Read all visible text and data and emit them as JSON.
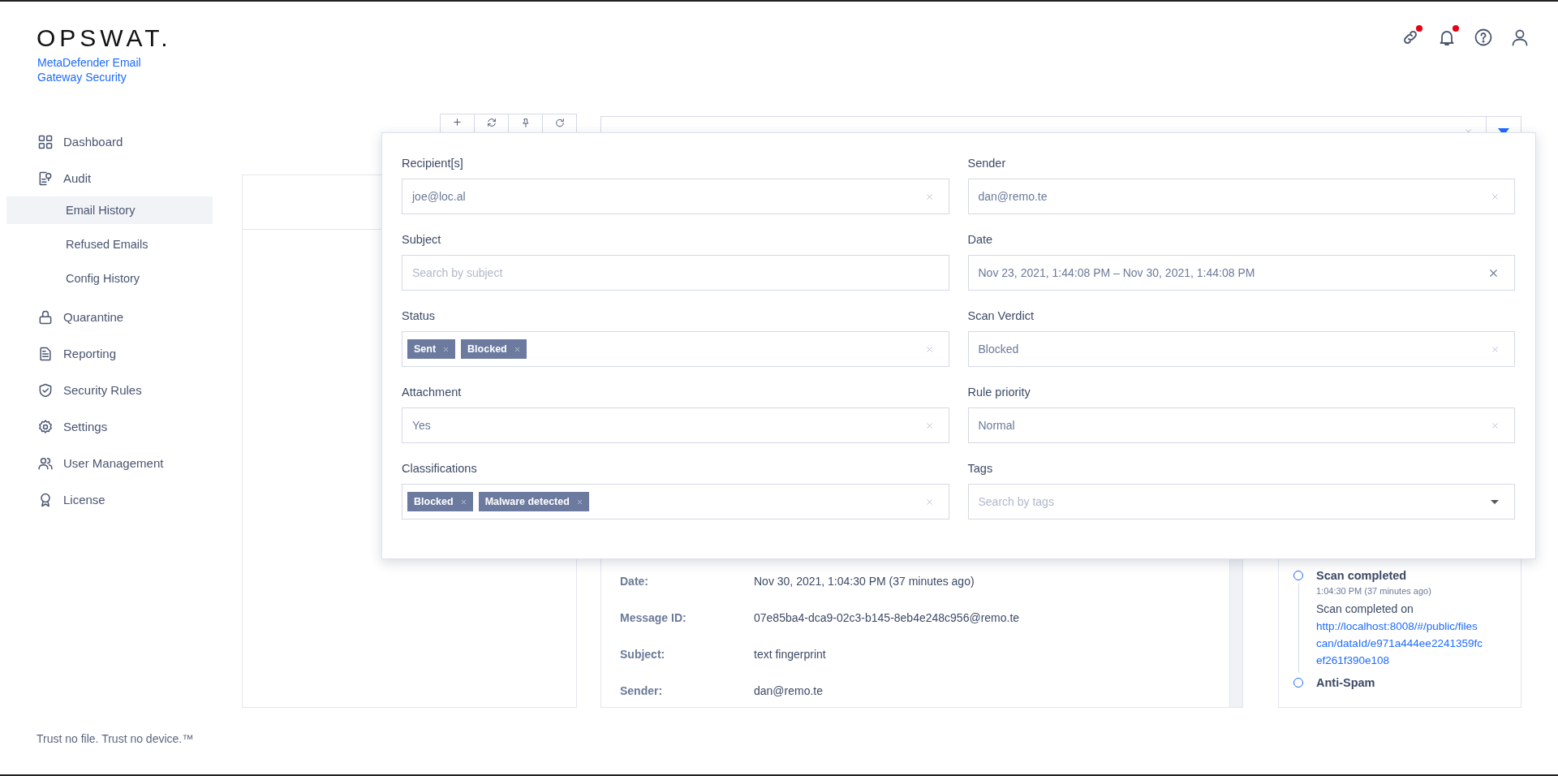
{
  "brand": {
    "logo": "OPSWAT.",
    "product": "MetaDefender Email Gateway Security"
  },
  "header_icons": [
    {
      "kind": "link",
      "badge": true
    },
    {
      "kind": "bell",
      "badge": true
    },
    {
      "kind": "help",
      "badge": false
    },
    {
      "kind": "user",
      "badge": false
    }
  ],
  "sidebar": {
    "items": [
      {
        "label": "Dashboard",
        "kind": "grid",
        "selected": false
      },
      {
        "label": "Audit",
        "kind": "audit",
        "selected": false,
        "children": [
          {
            "label": "Email History",
            "selected": true
          },
          {
            "label": "Refused Emails",
            "selected": false
          },
          {
            "label": "Config History",
            "selected": false
          }
        ]
      },
      {
        "label": "Quarantine",
        "kind": "lock",
        "selected": false
      },
      {
        "label": "Reporting",
        "kind": "report",
        "selected": false
      },
      {
        "label": "Security Rules",
        "kind": "shield",
        "selected": false
      },
      {
        "label": "Settings",
        "kind": "gear",
        "selected": false
      },
      {
        "label": "User Management",
        "kind": "users",
        "selected": false
      },
      {
        "label": "License",
        "kind": "award",
        "selected": false
      }
    ]
  },
  "footer": "Trust no file. Trust no device.™",
  "toolbar": {
    "buttons": [
      {
        "kind": "add"
      },
      {
        "kind": "sync"
      },
      {
        "kind": "pin"
      },
      {
        "kind": "refresh"
      }
    ]
  },
  "filter_panel": {
    "fields": [
      {
        "label": "Recipient[s]",
        "kind": "text",
        "value": "joe@loc.al",
        "clearable": true
      },
      {
        "label": "Sender",
        "kind": "text",
        "value": "dan@remo.te",
        "clearable": true
      },
      {
        "label": "Subject",
        "kind": "text",
        "placeholder": "Search by subject",
        "clearable": false
      },
      {
        "label": "Date",
        "kind": "date",
        "value": "Nov 23, 2021, 1:44:08 PM – Nov 30, 2021, 1:44:08 PM",
        "clearable": true
      },
      {
        "label": "Status",
        "kind": "tags",
        "tags": [
          "Sent",
          "Blocked"
        ],
        "clearable": true
      },
      {
        "label": "Scan Verdict",
        "kind": "text",
        "value": "Blocked",
        "clearable": true
      },
      {
        "label": "Attachment",
        "kind": "text",
        "value": "Yes",
        "clearable": true
      },
      {
        "label": "Rule priority",
        "kind": "text",
        "value": "Normal",
        "clearable": true
      },
      {
        "label": "Classifications",
        "kind": "tags",
        "tags": [
          "Blocked",
          "Malware detected"
        ],
        "clearable": true
      },
      {
        "label": "Tags",
        "kind": "select",
        "placeholder": "Search by tags",
        "clearable": false
      }
    ]
  },
  "details": {
    "rows": [
      {
        "label": "Date:",
        "value": "Nov 30, 2021, 1:04:30 PM (37 minutes ago)"
      },
      {
        "label": "Message ID:",
        "value": "07e85ba4-dca9-02c3-b145-8eb4e248c956@remo.te"
      },
      {
        "label": "Subject:",
        "value": "text fingerprint"
      },
      {
        "label": "Sender:",
        "value": "dan@remo.te"
      }
    ]
  },
  "timeline": {
    "events": [
      {
        "title": "Scan completed",
        "time": "1:04:30 PM (37 minutes ago)",
        "text": "Scan completed on",
        "link": "http://localhost:8008/#/public/filescan/dataId/e971a444ee2241359fcef261f390e108"
      },
      {
        "title": "Anti-Spam"
      }
    ]
  }
}
